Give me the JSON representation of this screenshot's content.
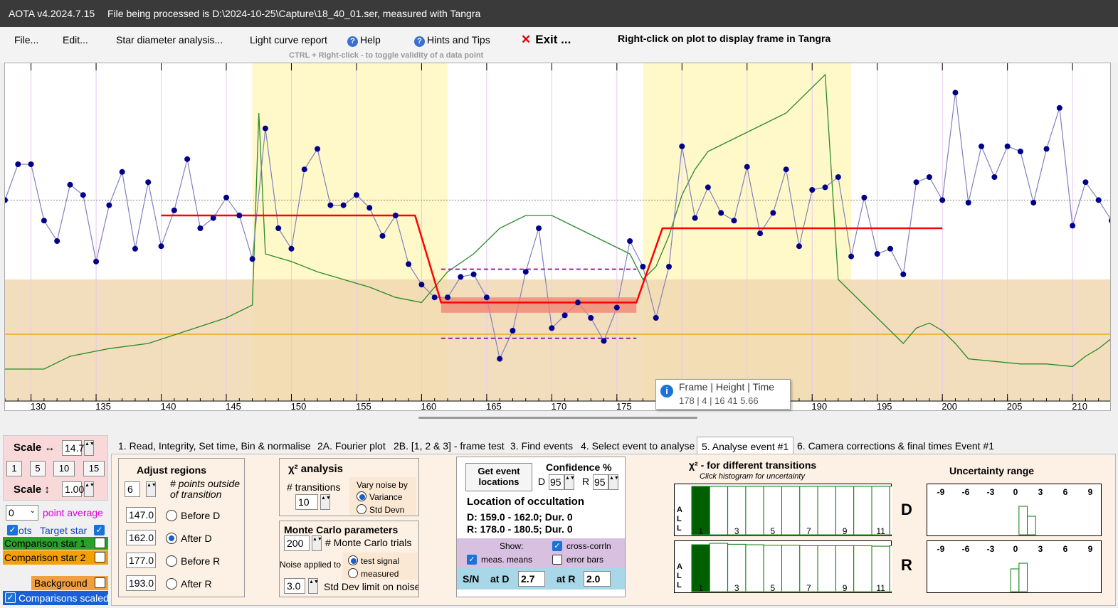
{
  "titlebar": {
    "app_name": "AOTA v4.2024.7.15",
    "file_info": "File being processed is D:\\2024-10-25\\Capture\\18_40_01.ser, measured with Tangra"
  },
  "menu": {
    "file": "File...",
    "edit": "Edit...",
    "star_diameter": "Star diameter analysis...",
    "light_curve": "Light curve report",
    "help": "Help",
    "hints": "Hints and Tips",
    "exit": "Exit ...",
    "right_click_hint": "Right-click on plot to display frame in Tangra",
    "ctrl_hint": "CTRL + Right-click  -  to toggle validity of a data point"
  },
  "tooltip": {
    "header": "Frame | Height | Time",
    "values": "178 |  4 | 16 41  5.66"
  },
  "chart_data": {
    "type": "line",
    "title": "",
    "xlabel": "",
    "ylabel": "",
    "xlim": [
      128,
      213
    ],
    "ylim": [
      0,
      100
    ],
    "x_ticks": [
      130,
      135,
      140,
      145,
      150,
      155,
      160,
      165,
      170,
      175,
      180,
      185,
      190,
      195,
      200,
      205,
      210
    ],
    "x_tick_labels": [
      "130",
      "135",
      "140",
      "145",
      "150",
      "155",
      "160",
      "165",
      "170",
      "175",
      "",
      "",
      "190",
      "195",
      "200",
      "205",
      "210"
    ],
    "event_regions": [
      [
        147.0,
        162.0
      ],
      [
        177.0,
        193.0
      ]
    ],
    "background_band_top": 35,
    "colors": {
      "target": "#00008b",
      "target_line": "#8080c0",
      "model": "#ff0000",
      "comparison": "#2a8a2a",
      "background": "#f0d8b0",
      "highlight": "#fff8c8",
      "bg_line": "#f0a000"
    },
    "series": [
      {
        "name": "Target star",
        "x": [
          128,
          129,
          130,
          131,
          132,
          133,
          134,
          135,
          136,
          137,
          138,
          139,
          140,
          141,
          142,
          143,
          144,
          145,
          146,
          147,
          148,
          149,
          150,
          151,
          152,
          153,
          154,
          155,
          156,
          157,
          158,
          159,
          160,
          161,
          162,
          163,
          164,
          165,
          166,
          167,
          168,
          169,
          170,
          171,
          172,
          173,
          174,
          175,
          176,
          177,
          178,
          179,
          180,
          181,
          182,
          183,
          184,
          185,
          186,
          187,
          188,
          189,
          190,
          191,
          192,
          193,
          194,
          195,
          196,
          197,
          198,
          199,
          200,
          201,
          202,
          203,
          204,
          205,
          206,
          207,
          208,
          209,
          210,
          211,
          212,
          213
        ],
        "y": [
          66,
          80,
          80,
          58,
          50,
          72,
          68,
          42,
          64,
          77,
          47,
          73,
          48,
          62,
          82,
          55,
          59,
          67,
          60,
          43,
          94,
          55,
          47,
          78,
          86,
          64,
          64,
          68,
          63,
          52,
          60,
          41,
          33,
          28,
          28,
          36,
          37,
          28,
          4,
          15,
          38,
          55,
          16,
          21,
          26,
          20,
          11,
          24,
          50,
          40,
          20,
          40,
          87,
          59,
          71,
          61,
          58,
          79,
          53,
          61,
          78,
          48,
          70,
          71,
          75,
          44,
          67,
          45,
          47,
          37,
          73,
          75,
          66,
          108,
          65,
          87,
          75,
          87,
          85,
          65,
          86,
          102,
          56,
          73,
          66,
          58
        ]
      },
      {
        "name": "Comparison star 1",
        "x": [
          128,
          131,
          133,
          136,
          139,
          142,
          145,
          147,
          147.5,
          148,
          150,
          152,
          154,
          156,
          158,
          160,
          162,
          164,
          166,
          168,
          170,
          172,
          174,
          176,
          177,
          178,
          179,
          180,
          181,
          182,
          184,
          186,
          188,
          190,
          191,
          192,
          193,
          194,
          195,
          196,
          197,
          198,
          199,
          200,
          201,
          202,
          204,
          206,
          208,
          210,
          211,
          212,
          213
        ],
        "y": [
          0,
          0,
          5,
          8,
          10,
          15,
          20,
          25,
          100,
          45,
          42,
          38,
          35,
          32,
          28,
          26,
          38,
          45,
          55,
          60,
          60,
          55,
          50,
          45,
          35,
          40,
          52,
          68,
          78,
          85,
          90,
          95,
          100,
          110,
          115,
          35,
          30,
          25,
          20,
          15,
          10,
          16,
          18,
          15,
          10,
          4,
          3,
          2,
          2,
          1,
          5,
          8,
          12
        ]
      }
    ],
    "model": {
      "name": "Model fit",
      "x": [
        140,
        159.5,
        161.5,
        176.5,
        178.5,
        200
      ],
      "y": [
        60,
        60,
        26,
        26,
        55,
        55
      ]
    }
  },
  "tabs": [
    "1.  Read, Integrity, Set time, Bin & normalise",
    "2A. Fourier plot",
    "2B. [1, 2 & 3] - frame test",
    "3. Find events",
    "4. Select event to analyse",
    "5. Analyse event #1",
    "6. Camera corrections & final times Event #1"
  ],
  "left_panel": {
    "scale_h_label": "Scale ↔",
    "scale_h_value": "14.7",
    "scale_buttons": [
      "1",
      "5",
      "10",
      "15"
    ],
    "scale_v_label": "Scale ↕",
    "scale_v_value": "1.00",
    "point_avg_value": "0",
    "point_avg_label": "point average",
    "dots_label": "ots",
    "target_label": "Target star",
    "comp1_label": "Comparison star 1",
    "comp2_label": "Comparison star 2",
    "background_label": "Background",
    "comparisons_scaled_label": "Comparisons scaled"
  },
  "adjust_regions": {
    "title": "Adjust regions",
    "points_value": "6",
    "points_label": "# points outside of transition",
    "before_d_value": "147.0",
    "before_d_label": "Before D",
    "after_d_value": "162.0",
    "after_d_label": "After D",
    "before_r_value": "177.0",
    "before_r_label": "Before R",
    "after_r_value": "193.0",
    "after_r_label": "After R"
  },
  "chi2": {
    "title": "χ² analysis",
    "transitions_label": "# transitions",
    "transitions_value": "10",
    "vary_label": "Vary noise by",
    "variance_label": "Variance",
    "std_label": "Std Devn"
  },
  "monte_carlo": {
    "title": "Monte Carlo parameters",
    "trials_value": "200",
    "trials_label": "# Monte Carlo trials",
    "noise_label": "Noise applied to",
    "test_signal": "test signal",
    "measured": "measured",
    "std_value": "3.0",
    "std_label": "Std Dev limit on noise"
  },
  "event_panel": {
    "get_btn": "Get event locations",
    "confidence_title": "Confidence %",
    "d_label": "D",
    "d_value": "95",
    "r_label": "R",
    "r_value": "95",
    "location_title": "Location of occultation",
    "d_line": "D: 159.0 - 162.0; Dur. 0",
    "r_line": "R: 178.0 - 180.5; Dur. 0",
    "show_label": "Show:",
    "cross_corr": "cross-corrln",
    "meas_means": "meas. means",
    "error_bars": "error bars",
    "sn_label": "S/N",
    "at_d_label": "at D",
    "at_d_value": "2.7",
    "at_r_label": "at R",
    "at_r_value": "2.0"
  },
  "chi2_hist": {
    "title": "χ² - for different transitions",
    "subtitle": "Click histogram for uncertainty",
    "all_label": [
      "A",
      "L",
      "L"
    ],
    "tick_labels": [
      "1",
      "3",
      "5",
      "7",
      "9",
      "11"
    ],
    "d_label": "D",
    "r_label": "R",
    "d_values": [
      1.0,
      1.0,
      1.0,
      1.0,
      1.0,
      1.0,
      1.0,
      1.0,
      1.0,
      1.0,
      1.0,
      1.0
    ],
    "r_values": [
      0.97,
      1.0,
      0.98,
      0.97,
      0.96,
      0.96,
      0.95,
      0.95,
      0.95,
      0.95,
      0.94,
      0.95
    ]
  },
  "uncertainty": {
    "title": "Uncertainty range",
    "ticks": [
      "-9",
      "-6",
      "-3",
      "0",
      "3",
      "6",
      "9"
    ],
    "d_values": [
      0,
      0,
      0,
      0,
      0,
      0,
      0,
      0,
      0,
      0,
      1.0,
      0.65,
      0,
      0,
      0,
      0,
      0,
      0,
      0
    ],
    "r_values": [
      0,
      0,
      0,
      0,
      0,
      0,
      0,
      0,
      0,
      0.8,
      1.0,
      0,
      0,
      0,
      0,
      0,
      0,
      0,
      0
    ]
  }
}
